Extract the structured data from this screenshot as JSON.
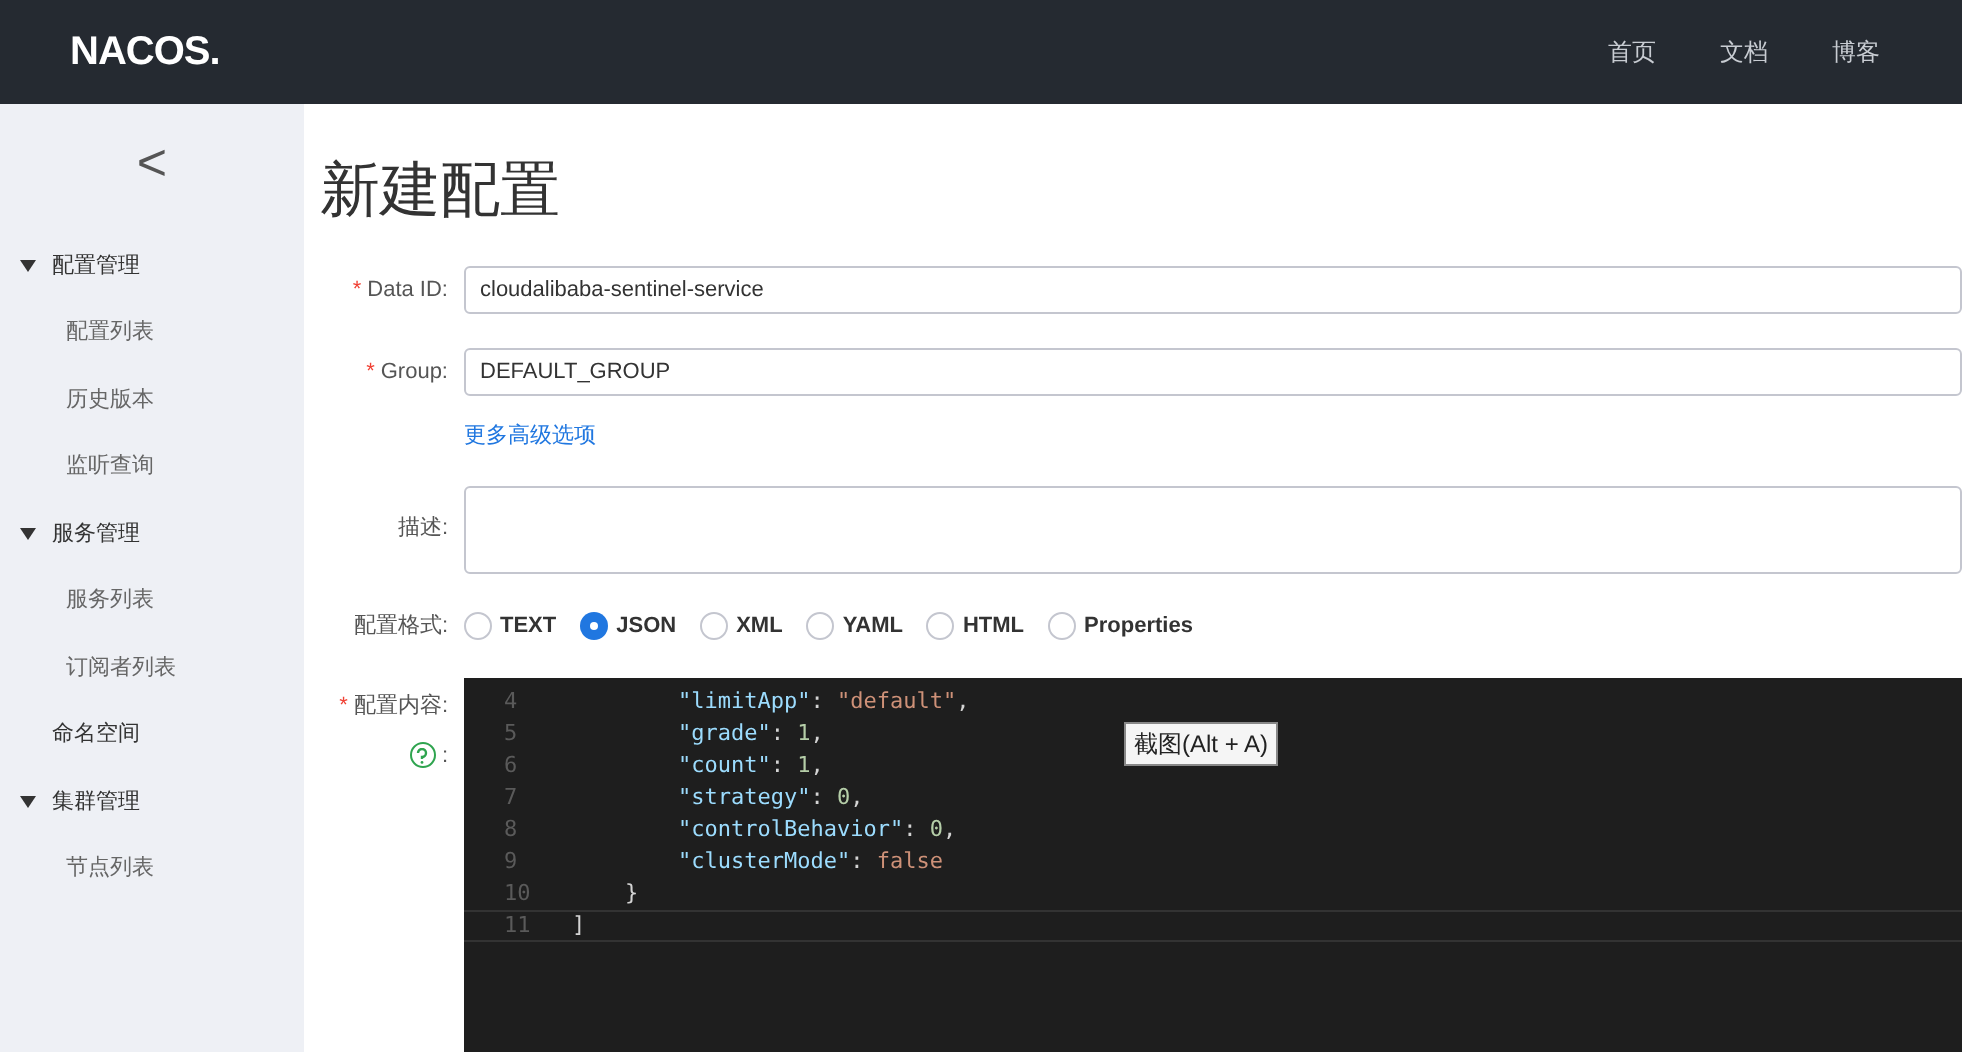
{
  "header": {
    "logo": "NACOS.",
    "nav": [
      {
        "label": "首页"
      },
      {
        "label": "文档"
      },
      {
        "label": "博客"
      }
    ]
  },
  "sidebar": {
    "collapse": "<",
    "items": [
      {
        "label": "配置管理",
        "expanded": true,
        "children": [
          {
            "label": "配置列表"
          },
          {
            "label": "历史版本"
          },
          {
            "label": "监听查询"
          }
        ]
      },
      {
        "label": "服务管理",
        "expanded": true,
        "children": [
          {
            "label": "服务列表"
          },
          {
            "label": "订阅者列表"
          }
        ]
      },
      {
        "label": "命名空间"
      },
      {
        "label": "集群管理",
        "expanded": true,
        "children": [
          {
            "label": "节点列表"
          }
        ]
      }
    ]
  },
  "page_title": "新建配置",
  "form": {
    "data_id": {
      "label": "Data ID:",
      "required_mark": "*",
      "value": "cloudalibaba-sentinel-service"
    },
    "group": {
      "label": "Group:",
      "required_mark": "*",
      "value": "DEFAULT_GROUP"
    },
    "advanced_link": "更多高级选项",
    "description": {
      "label": "描述:"
    },
    "format": {
      "label": "配置格式:",
      "options": [
        {
          "label": "TEXT",
          "selected": false
        },
        {
          "label": "JSON",
          "selected": true
        },
        {
          "label": "XML",
          "selected": false
        },
        {
          "label": "YAML",
          "selected": false
        },
        {
          "label": "HTML",
          "selected": false
        },
        {
          "label": "Properties",
          "selected": false
        }
      ]
    },
    "content": {
      "label": "配置内容:",
      "required_mark": "*",
      "help_suffix": ":"
    }
  },
  "editor": {
    "lines": [
      {
        "number": "4",
        "tokens": [
          {
            "kind": "key",
            "text": "        \"limitApp\""
          },
          {
            "kind": "punct",
            "text": ": "
          },
          {
            "kind": "string",
            "text": "\"default\""
          },
          {
            "kind": "punct",
            "text": ","
          }
        ]
      },
      {
        "number": "5",
        "tokens": [
          {
            "kind": "key",
            "text": "        \"grade\""
          },
          {
            "kind": "punct",
            "text": ": "
          },
          {
            "kind": "number",
            "text": "1"
          },
          {
            "kind": "punct",
            "text": ","
          }
        ]
      },
      {
        "number": "6",
        "tokens": [
          {
            "kind": "key",
            "text": "        \"count\""
          },
          {
            "kind": "punct",
            "text": ": "
          },
          {
            "kind": "number",
            "text": "1"
          },
          {
            "kind": "punct",
            "text": ","
          }
        ]
      },
      {
        "number": "7",
        "tokens": [
          {
            "kind": "key",
            "text": "        \"strategy\""
          },
          {
            "kind": "punct",
            "text": ": "
          },
          {
            "kind": "number",
            "text": "0"
          },
          {
            "kind": "punct",
            "text": ","
          }
        ]
      },
      {
        "number": "8",
        "tokens": [
          {
            "kind": "key",
            "text": "        \"controlBehavior\""
          },
          {
            "kind": "punct",
            "text": ": "
          },
          {
            "kind": "number",
            "text": "0"
          },
          {
            "kind": "punct",
            "text": ","
          }
        ]
      },
      {
        "number": "9",
        "tokens": [
          {
            "kind": "key",
            "text": "        \"clusterMode\""
          },
          {
            "kind": "punct",
            "text": ": "
          },
          {
            "kind": "keyword",
            "text": "false"
          }
        ]
      },
      {
        "number": "10",
        "tokens": [
          {
            "kind": "punct",
            "text": "    }"
          }
        ]
      },
      {
        "number": "11",
        "tokens": [
          {
            "kind": "punct",
            "text": "]"
          }
        ]
      }
    ]
  },
  "tooltip": "截图(Alt + A)"
}
